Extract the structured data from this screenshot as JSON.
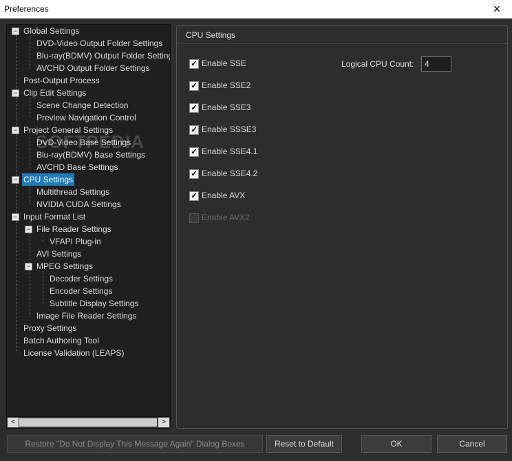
{
  "window": {
    "title": "Preferences",
    "close_icon": "×"
  },
  "watermark": "SOFTPEDIA",
  "tree": {
    "items": [
      {
        "label": "Global Settings"
      },
      {
        "label": "DVD-Video Output Folder Settings"
      },
      {
        "label": "Blu-ray(BDMV) Output Folder Settings"
      },
      {
        "label": "AVCHD Output Folder Settings"
      },
      {
        "label": "Post-Output Process"
      },
      {
        "label": "Clip Edit Settings"
      },
      {
        "label": "Scene Change Detection"
      },
      {
        "label": "Preview Navigation Control"
      },
      {
        "label": "Project General Settings"
      },
      {
        "label": "DVD-Video Base Settings"
      },
      {
        "label": "Blu-ray(BDMV) Base Settings"
      },
      {
        "label": "AVCHD Base Settings"
      },
      {
        "label": "CPU Settings"
      },
      {
        "label": "Multithread Settings"
      },
      {
        "label": "NVIDIA CUDA Settings"
      },
      {
        "label": "Input Format List"
      },
      {
        "label": "File Reader Settings"
      },
      {
        "label": "VFAPI Plug-in"
      },
      {
        "label": "AVI Settings"
      },
      {
        "label": "MPEG Settings"
      },
      {
        "label": "Decoder Settings"
      },
      {
        "label": "Encoder Settings"
      },
      {
        "label": "Subtitle Display Settings"
      },
      {
        "label": "Image File Reader Settings"
      },
      {
        "label": "Proxy Settings"
      },
      {
        "label": "Batch Authoring Tool"
      },
      {
        "label": "License Validation (LEAPS)"
      }
    ],
    "expand_glyph": "−",
    "scroll_left": "<",
    "scroll_right": ">"
  },
  "cpu_settings": {
    "title": "CPU Settings",
    "checkboxes": [
      {
        "label": "Enable SSE",
        "checked": true,
        "enabled": true
      },
      {
        "label": "Enable SSE2",
        "checked": true,
        "enabled": true
      },
      {
        "label": "Enable SSE3",
        "checked": true,
        "enabled": true
      },
      {
        "label": "Enable SSSE3",
        "checked": true,
        "enabled": true
      },
      {
        "label": "Enable SSE4.1",
        "checked": true,
        "enabled": true
      },
      {
        "label": "Enable SSE4.2",
        "checked": true,
        "enabled": true
      },
      {
        "label": "Enable AVX",
        "checked": true,
        "enabled": true
      },
      {
        "label": "Enable AVX2",
        "checked": false,
        "enabled": false
      }
    ],
    "check_glyph": "✓",
    "logical_cpu_label": "Logical CPU Count:",
    "logical_cpu_value": "4"
  },
  "buttons": {
    "restore": "Restore \"Do Not Display This Message Again\" Dialog Boxes",
    "reset": "Reset to Default",
    "ok": "OK",
    "cancel": "Cancel"
  },
  "colors": {
    "selection": "#1f7bb6",
    "background": "#2d2d2d",
    "tree_background": "#1f1f1f"
  }
}
